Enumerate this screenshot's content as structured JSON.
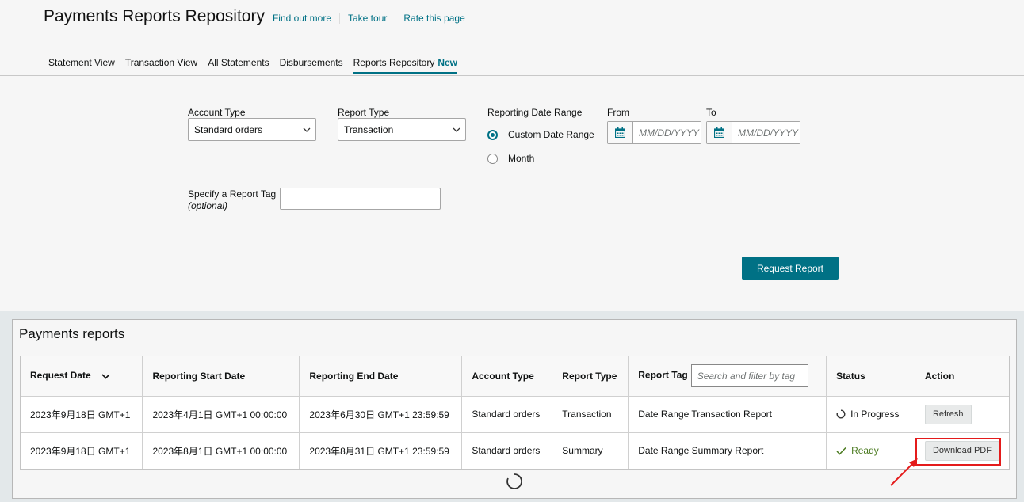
{
  "header": {
    "title": "Payments Reports Repository",
    "links": [
      "Find out more",
      "Take tour",
      "Rate this page"
    ]
  },
  "tabs": [
    {
      "label": "Statement View"
    },
    {
      "label": "Transaction View"
    },
    {
      "label": "All Statements"
    },
    {
      "label": "Disbursements"
    },
    {
      "label": "Reports Repository",
      "badge": "New",
      "active": true
    }
  ],
  "form": {
    "account_type": {
      "label": "Account Type",
      "value": "Standard orders"
    },
    "report_type": {
      "label": "Report Type",
      "value": "Transaction"
    },
    "date_range": {
      "label": "Reporting Date Range",
      "options": [
        {
          "label": "Custom Date Range",
          "checked": true
        },
        {
          "label": "Month",
          "checked": false
        }
      ]
    },
    "from": {
      "label": "From",
      "placeholder": "MM/DD/YYYY"
    },
    "to": {
      "label": "To",
      "placeholder": "MM/DD/YYYY"
    },
    "report_tag": {
      "label": "Specify a Report Tag",
      "hint": "(optional)"
    },
    "submit_label": "Request Report"
  },
  "reports": {
    "title": "Payments reports",
    "columns": [
      "Request Date",
      "Reporting Start Date",
      "Reporting End Date",
      "Account Type",
      "Report Type",
      "Report Tag",
      "Status",
      "Action"
    ],
    "tag_filter_placeholder": "Search and filter by tag",
    "rows": [
      {
        "request_date": "2023年9月18日 GMT+1",
        "start_date": "2023年4月1日 GMT+1 00:00:00",
        "end_date": "2023年6月30日 GMT+1 23:59:59",
        "account_type": "Standard orders",
        "report_type": "Transaction",
        "report_tag": "Date Range Transaction Report",
        "status": "In Progress",
        "action": "Refresh"
      },
      {
        "request_date": "2023年9月18日 GMT+1",
        "start_date": "2023年8月1日 GMT+1 00:00:00",
        "end_date": "2023年8月31日 GMT+1 23:59:59",
        "account_type": "Standard orders",
        "report_type": "Summary",
        "report_tag": "Date Range Summary Report",
        "status": "Ready",
        "action": "Download PDF"
      }
    ]
  },
  "colors": {
    "accent": "#007185",
    "highlight": "#e41b1b",
    "ready": "#4a7a1f"
  }
}
